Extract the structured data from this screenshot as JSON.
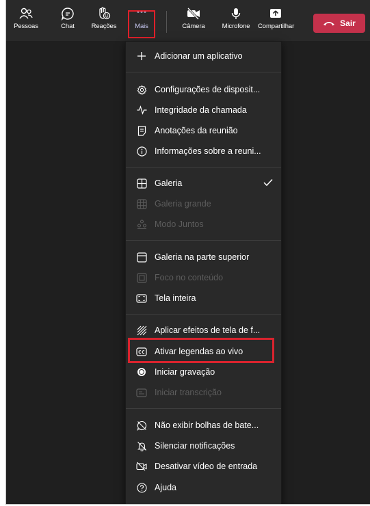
{
  "toolbar": {
    "people": "Pessoas",
    "chat": "Chat",
    "reactions": "Reações",
    "more": "Mais",
    "camera": "Câmera",
    "microphone": "Microfone",
    "share": "Compartilhar",
    "leave": "Sair"
  },
  "menu": {
    "add_app": "Adicionar um aplicativo",
    "device_settings": "Configurações de disposit...",
    "call_health": "Integridade da chamada",
    "meeting_notes": "Anotações da reunião",
    "meeting_info": "Informações sobre a reuni...",
    "gallery": "Galeria",
    "large_gallery": "Galeria grande",
    "together_mode": "Modo Juntos",
    "gallery_top": "Galeria na parte superior",
    "focus_content": "Foco no conteúdo",
    "full_screen": "Tela inteira",
    "background_effects": "Aplicar efeitos de tela de f...",
    "live_captions": "Ativar legendas ao vivo",
    "start_recording": "Iniciar gravação",
    "start_transcription": "Iniciar transcrição",
    "hide_chat_bubbles": "Não exibir bolhas de bate...",
    "mute_notifications": "Silenciar notificações",
    "turn_off_video": "Desativar vídeo de entrada",
    "help": "Ajuda"
  },
  "colors": {
    "leave_button": "#c4314b",
    "highlight_border": "#d9232e",
    "menu_background": "#292929"
  }
}
